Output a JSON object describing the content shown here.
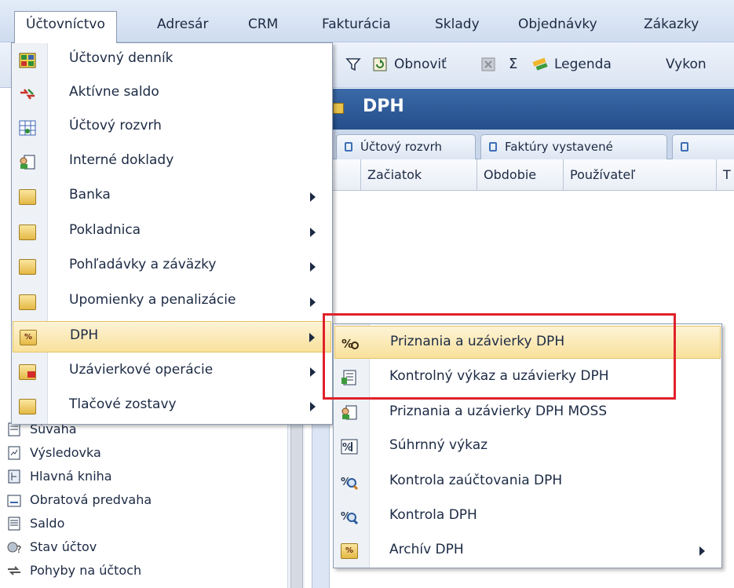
{
  "menubar": {
    "items": [
      "Účtovníctvo",
      "Adresár",
      "CRM",
      "Fakturácia",
      "Sklady",
      "Objednávky",
      "Zákazky"
    ]
  },
  "toolbar": {
    "refresh_label": "Obnoviť",
    "sum_symbol": "Σ",
    "legend_label": "Legenda",
    "execute_label": "Vykon"
  },
  "panel": {
    "title": "DPH",
    "tabs": [
      "Účtový rozvrh",
      "Faktúry vystavené"
    ],
    "columns": [
      "Začiatok",
      "Obdobie",
      "Používateľ",
      "T"
    ]
  },
  "dropdown": {
    "items": [
      {
        "label": "Účtovný denník",
        "icon": "journal-icon",
        "submenu": false
      },
      {
        "label": "Aktívne saldo",
        "icon": "saldo-icon",
        "submenu": false
      },
      {
        "label": "Účtový rozvrh",
        "icon": "chart-of-accounts-icon",
        "submenu": false
      },
      {
        "label": "Interné doklady",
        "icon": "internal-docs-icon",
        "submenu": false
      },
      {
        "label": "Banka",
        "icon": "bank-folder-icon",
        "submenu": true
      },
      {
        "label": "Pokladnica",
        "icon": "cash-folder-icon",
        "submenu": true
      },
      {
        "label": "Pohľadávky a záväzky",
        "icon": "receivables-folder-icon",
        "submenu": true
      },
      {
        "label": "Upomienky a penalizácie",
        "icon": "reminders-folder-icon",
        "submenu": true
      },
      {
        "label": "DPH",
        "icon": "vat-folder-icon",
        "submenu": true
      },
      {
        "label": "Uzávierkové operácie",
        "icon": "closing-folder-icon",
        "submenu": true
      },
      {
        "label": "Tlačové zostavy",
        "icon": "print-folder-icon",
        "submenu": true
      }
    ]
  },
  "submenu": {
    "items": [
      {
        "label": "Priznania a uzávierky DPH",
        "icon": "vat-return-icon"
      },
      {
        "label": "Kontrolný výkaz a uzávierky DPH",
        "icon": "control-report-icon"
      },
      {
        "label": "Priznania a uzávierky DPH MOSS",
        "icon": "moss-icon"
      },
      {
        "label": "Súhrnný výkaz",
        "icon": "summary-report-icon"
      },
      {
        "label": "Kontrola zaúčtovania DPH",
        "icon": "posting-check-icon"
      },
      {
        "label": "Kontrola DPH",
        "icon": "vat-check-icon"
      },
      {
        "label": "Archív DPH",
        "icon": "vat-archive-icon"
      }
    ]
  },
  "behind_list": {
    "items": [
      {
        "label": "Súvaha",
        "icon": "balance-sheet-icon"
      },
      {
        "label": "Výsledovka",
        "icon": "income-statement-icon"
      },
      {
        "label": "Hlavná kniha",
        "icon": "general-ledger-icon"
      },
      {
        "label": "Obratová predvaha",
        "icon": "trial-balance-icon"
      },
      {
        "label": "Saldo",
        "icon": "saldo-doc-icon"
      },
      {
        "label": "Stav účtov",
        "icon": "account-status-icon"
      },
      {
        "label": "Pohyby na účtoch",
        "icon": "account-movements-icon"
      }
    ]
  },
  "colors": {
    "highlight": "#e0212a",
    "menu_hover": "#f9e19b",
    "panel_header": "#2d5a97"
  }
}
